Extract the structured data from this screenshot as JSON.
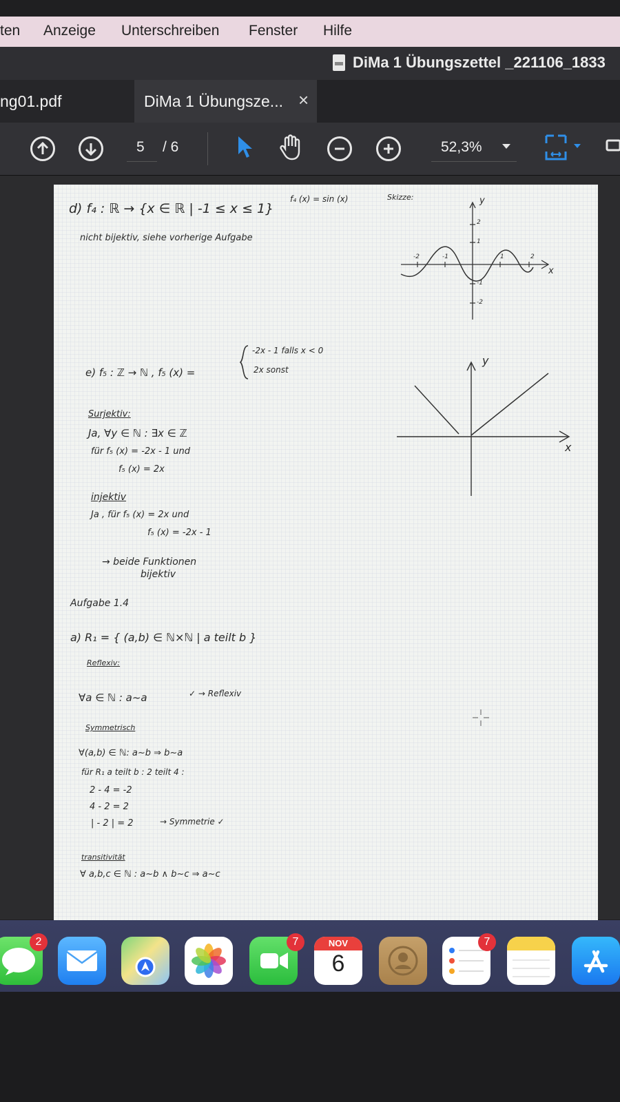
{
  "menubar": {
    "items": [
      "ten",
      "Anzeige",
      "Unterschreiben",
      "Fenster",
      "Hilfe"
    ]
  },
  "window": {
    "title": "DiMa 1 Übungszettel _221106_1833"
  },
  "tabs": [
    {
      "label": "ng01.pdf"
    },
    {
      "label": "DiMa 1 Übungsze...",
      "close": "×"
    }
  ],
  "toolbar": {
    "page_current": "5",
    "page_total": "/ 6",
    "zoom": "52,3%"
  },
  "document": {
    "d_heading": "d)  f₄ : ℝ → {x ∈ ℝ | -1 ≤ x ≤ 1}",
    "d_formula": "f₄ (x) = sin (x)",
    "d_sketch_label": "Skizze:",
    "d_text": "nicht bijektiv, siehe vorherige Aufgabe",
    "sketch1_ylabel": "y",
    "sketch1_xlabel": "x",
    "sketch1_ticks": [
      "2",
      "1",
      "-1",
      "-2",
      "-2",
      "-1",
      "1",
      "2"
    ],
    "e_heading": "e)  f₅ : ℤ → ℕ ,  f₅ (x) =",
    "e_case1": "-2x - 1     falls  x < 0",
    "e_case2": "2x               sonst",
    "sketch2_ylabel": "y",
    "sketch2_xlabel": "x",
    "surj_title": "Surjektiv:",
    "surj_l1": "Ja,  ∀y ∈ ℕ : ∃x ∈ ℤ",
    "surj_l2": "für   f₅ (x) = -2x - 1   und",
    "surj_l3": "f₅ (x) =  2x",
    "inj_title": "injektiv",
    "inj_l1": "Ja ,  für   f₅ (x) = 2x   und",
    "inj_l2": "f₅ (x) = -2x - 1",
    "bij_l1": "→  beide  Funktionen",
    "bij_l2": "bijektiv",
    "aufgabe": "Aufgabe 1.4",
    "a_heading": "a)  R₁  =  { (a,b) ∈ ℕ×ℕ | a teilt b }",
    "refl_title": "Reflexiv:",
    "refl_l1": "∀a ∈ ℕ : a~a",
    "refl_l2": "✓ →  Reflexiv",
    "sym_title": "Symmetrisch",
    "sym_l1": "∀(a,b) ∈ ℕ:    a~b  ⇒  b~a",
    "sym_l2": "für    R₁    a teilt b :   2  teilt 4 :",
    "sym_l3": "2 - 4 =  -2",
    "sym_l4": "4 - 2  =  2",
    "sym_l5": "| - 2 |  =  2",
    "sym_l6": "→  Symmetrie ✓",
    "trans_title": "transitivität",
    "trans_l1": "∀ a,b,c ∈ ℕ :  a~b ∧ b~c  ⇒  a~c"
  },
  "dock": {
    "messages_badge": "2",
    "facetime_badge": "7",
    "calendar_month": "NOV",
    "calendar_day": "6",
    "reminders_badge": "7"
  }
}
